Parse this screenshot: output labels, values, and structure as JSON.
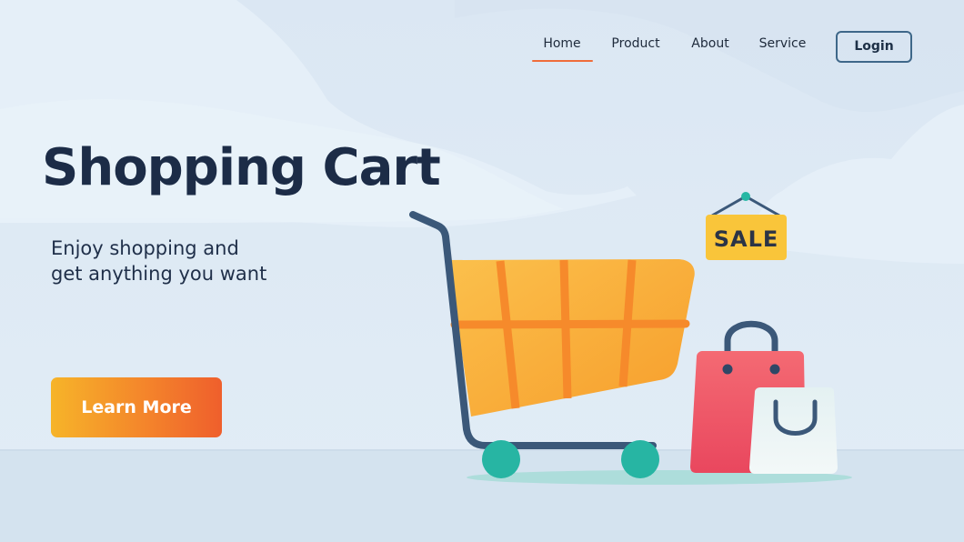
{
  "nav": {
    "items": [
      {
        "label": "Home",
        "active": true
      },
      {
        "label": "Product",
        "active": false
      },
      {
        "label": "About",
        "active": false
      },
      {
        "label": "Service",
        "active": false
      }
    ],
    "login_label": "Login"
  },
  "hero": {
    "title": "Shopping Cart",
    "subtitle_line1": "Enjoy shopping and",
    "subtitle_line2": "get anything you want",
    "cta_label": "Learn More"
  },
  "illustration": {
    "sale_sign": "SALE",
    "icons": [
      "shopping-cart-icon",
      "sale-sign-icon",
      "shopping-bag-icon"
    ]
  },
  "colors": {
    "background": "#dde9f4",
    "accent_orange": "#f4852b",
    "nav_underline": "#ef6c3a",
    "dark_navy": "#1c2c47",
    "cart_wheel": "#26b7a4",
    "sale_yellow": "#f9c53a",
    "bag_pink": "#ef5467"
  }
}
